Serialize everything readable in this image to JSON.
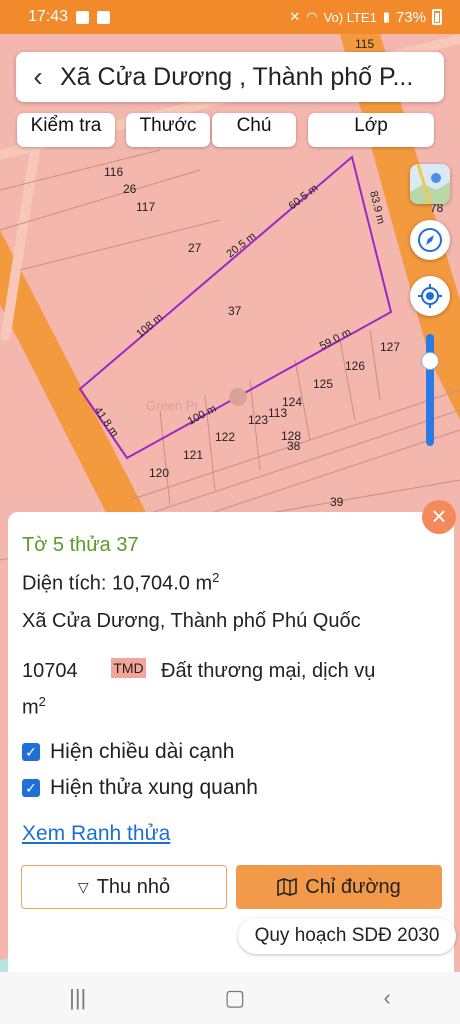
{
  "status_bar": {
    "time": "17:43",
    "network": "Vo) LTE1",
    "battery": "73%"
  },
  "header": {
    "title": "Xã Cửa Dương , Thành phố P..."
  },
  "chips": [
    {
      "label": "Kiểm tra"
    },
    {
      "label": "Thước"
    },
    {
      "label": "Chú"
    },
    {
      "label": "Lớp"
    }
  ],
  "map": {
    "parcel_labels": [
      "115",
      "116",
      "26",
      "117",
      "27",
      "37",
      "78",
      "127",
      "126",
      "125",
      "124",
      "113",
      "123",
      "122",
      "121",
      "120",
      "128",
      "38",
      "39"
    ],
    "edge_labels": [
      "60.5 m",
      "20.5 m",
      "83.9 m",
      "108 m",
      "59.0 m",
      "100 m",
      "41.8 m"
    ],
    "watermark": "Green Pr"
  },
  "info_card": {
    "title": "Tờ 5 thửa 37",
    "area_label": "Diện tích: 10,704.0 m",
    "area_exp": "2",
    "address": "Xã Cửa Dương, Thành phố Phú Quốc",
    "area_number": "10704",
    "area_unit": "m",
    "area_unit_exp": "2",
    "land_code": "TMD",
    "land_use": "Đất thương mại, dịch vụ",
    "show_edge_lengths": "Hiện chiều dài cạnh",
    "show_neighbors": "Hiện thửa xung quanh",
    "view_boundary": "Xem Ranh thửa",
    "collapse_button": "Thu nhỏ",
    "route_button": "Chỉ đường",
    "plan_label": "Quy hoạch SDĐ 2030"
  },
  "colors": {
    "status_bar": "#f28a2c",
    "parcel_fill": "#f4b7ae",
    "road": "#f39a3e",
    "boundary": "#9b27c9",
    "accent_blue": "#1f6fd6",
    "title_green": "#5a9b2a",
    "route_button": "#f39a4a"
  }
}
